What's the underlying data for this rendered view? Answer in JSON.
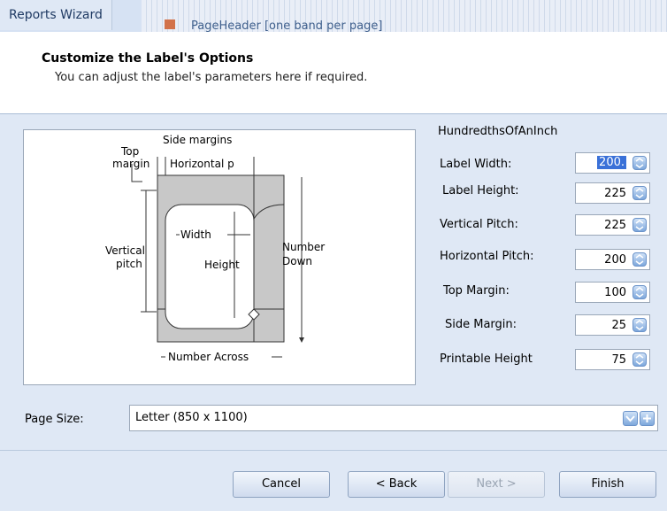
{
  "window": {
    "title": "Reports Wizard",
    "background_item": "PageHeader [one band per page]"
  },
  "header": {
    "title": "Customize the Label's Options",
    "subtitle": "You can adjust the label's parameters here if required."
  },
  "diagram": {
    "side_margins": "Side margins",
    "top_margin_1": "Top",
    "top_margin_2": "margin",
    "horizontal_pitch": "Horizontal p",
    "width": "Width",
    "height": "Height",
    "vertical_pitch_1": "Vertical",
    "vertical_pitch_2": "pitch",
    "number_down_1": "Number",
    "number_down_2": "Down",
    "number_across": "Number Across"
  },
  "units_label": "HundredthsOfAnInch",
  "params": [
    {
      "label": "Label Width:",
      "value": "200."
    },
    {
      "label": "Label Height:",
      "value": "225"
    },
    {
      "label": "Vertical Pitch:",
      "value": "225"
    },
    {
      "label": "Horizontal Pitch:",
      "value": "200"
    },
    {
      "label": "Top Margin:",
      "value": "100"
    },
    {
      "label": "Side Margin:",
      "value": "25"
    },
    {
      "label": "Printable Height",
      "value": "75"
    }
  ],
  "page_size": {
    "label": "Page Size:",
    "value": "Letter (850 x 1100)"
  },
  "buttons": {
    "cancel": "Cancel",
    "back": "< Back",
    "next": "Next >",
    "finish": "Finish"
  },
  "colors": {
    "accent": "#3a71d8",
    "panel": "#dfe8f5"
  }
}
